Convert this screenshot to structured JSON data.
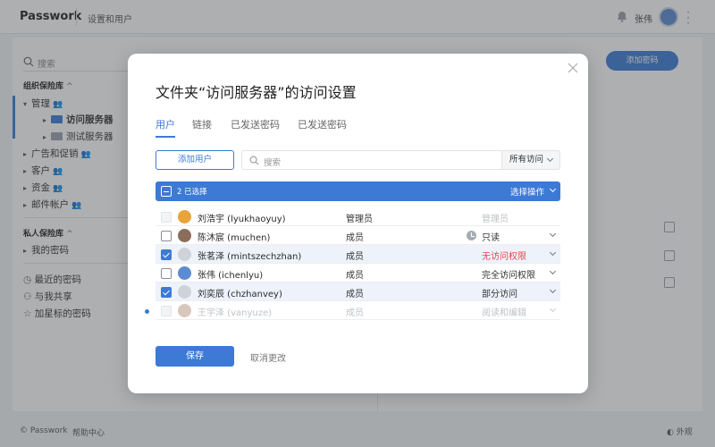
{
  "topbar": {
    "brand": "Passwork",
    "breadcrumb": "设置和用户",
    "user_name": "张伟"
  },
  "sidebar": {
    "search_placeholder": "搜索",
    "org_section": "组织保险库",
    "items": [
      {
        "label": "管理"
      },
      {
        "label": "访问服务器"
      },
      {
        "label": "测试服务器"
      },
      {
        "label": "广告和促销"
      },
      {
        "label": "客户"
      },
      {
        "label": "资金"
      },
      {
        "label": "邮件帐户"
      }
    ],
    "private_section": "私人保险库",
    "my_passwords": "我的密码",
    "recent": "最近的密码",
    "shared": "与我共享",
    "starred": "加星标的密码"
  },
  "main": {
    "add_password": "添加密码"
  },
  "footer": {
    "copyright": "© Passwork",
    "help": "帮助中心",
    "appearance": "外观"
  },
  "modal": {
    "title": "文件夹“访问服务器”的访问设置",
    "tabs": [
      "用户",
      "链接",
      "已发送密码",
      "已发送密码"
    ],
    "add_user": "添加用户",
    "search_placeholder": "搜索",
    "filter": "所有访问",
    "selection": {
      "count": "2 已选择",
      "action": "选择操作"
    },
    "users": [
      {
        "name": "刘浩宇 (lyukhaoyuy)",
        "role": "管理员",
        "access": "管理员"
      },
      {
        "name": "陈沐宸 (muchen)",
        "role": "成员",
        "access": "只读"
      },
      {
        "name": "张茗泽 (mintszechzhan)",
        "role": "成员",
        "access": "无访问权限"
      },
      {
        "name": "张伟 (ichenlyu)",
        "role": "成员",
        "access": "完全访问权限"
      },
      {
        "name": "刘奕辰 (chzhanvey)",
        "role": "成员",
        "access": "部分访问"
      },
      {
        "name": "王宇泽 (vanyuze)",
        "role": "成员",
        "access": "阅读和编辑"
      }
    ],
    "save": "保存",
    "cancel": "取消更改"
  },
  "colors": {
    "accent": "#3c7ad6",
    "danger": "#e24b4b"
  }
}
